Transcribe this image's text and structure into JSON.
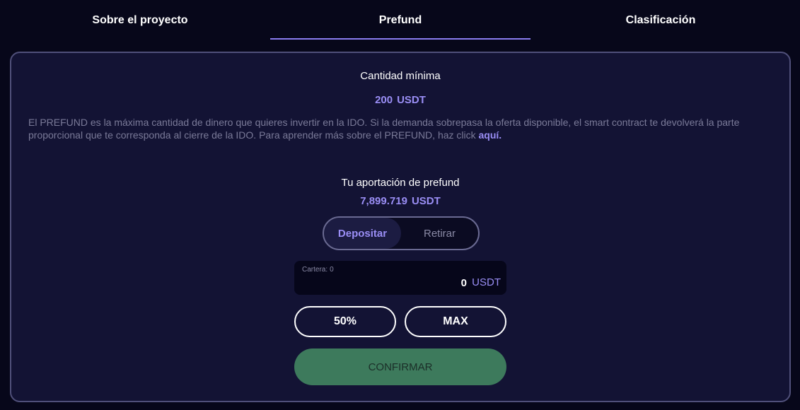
{
  "tabs": [
    {
      "label": "Sobre el proyecto"
    },
    {
      "label": "Prefund"
    },
    {
      "label": "Clasificación"
    }
  ],
  "minimum": {
    "label": "Cantidad mínima",
    "amount": "200",
    "unit": "USDT"
  },
  "description": {
    "text": "El PREFUND es la máxima cantidad de dinero que quieres invertir en la IDO. Si la demanda sobrepasa la oferta disponible, el smart contract te devolverá la parte proporcional que te corresponda al cierre de la IDO. Para aprender más sobre el PREFUND, haz click ",
    "link": "aquí."
  },
  "contribution": {
    "label": "Tu aportación de prefund",
    "amount": "7,899.719",
    "unit": "USDT"
  },
  "toggle": {
    "deposit": "Depositar",
    "withdraw": "Retirar"
  },
  "amount_field": {
    "wallet_label": "Cartera:",
    "wallet_balance": "0",
    "value": "0",
    "unit": "USDT"
  },
  "buttons": {
    "fifty": "50%",
    "max": "MAX",
    "confirm": "CONFIRMAR"
  }
}
